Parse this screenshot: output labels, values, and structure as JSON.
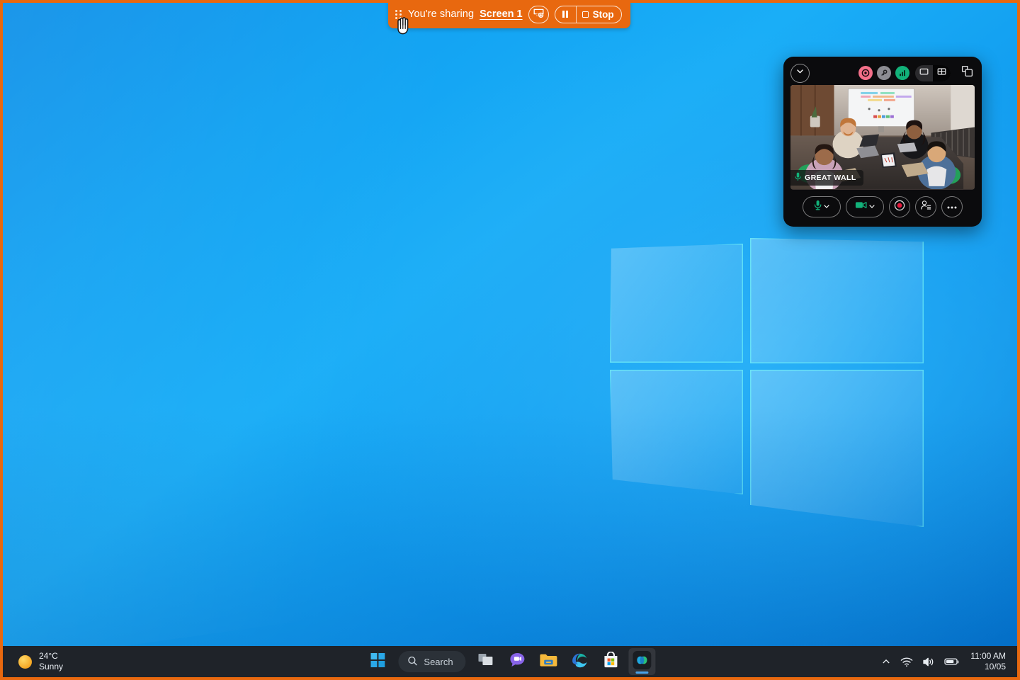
{
  "share_bar": {
    "drag_handle_icon": "drag-dots-icon",
    "prefix_text": "You're sharing",
    "target_label": "Screen 1",
    "share_new_icon": "share-new-content-icon",
    "pause_icon": "pause-icon",
    "pause_label": "Pause",
    "stop_label": "Stop",
    "stop_icon": "stop-square-icon",
    "accent_color": "#e8680f"
  },
  "cursor": {
    "type": "grab-hand-cursor"
  },
  "webex_panel": {
    "collapse_icon": "chevron-down-icon",
    "status_icons": [
      {
        "name": "recording-indicator-icon",
        "color": "#f4708a",
        "label": "Recording"
      },
      {
        "name": "meeting-lock-icon",
        "color": "#8d8d93",
        "label": "Locked"
      },
      {
        "name": "network-signal-icon",
        "color": "#12b27a",
        "label": "Connection good"
      }
    ],
    "layout_toggle": {
      "options": [
        {
          "name": "layout-stack-icon",
          "label": "Stack",
          "active": false
        },
        {
          "name": "layout-grid-icon",
          "label": "Grid",
          "active": true
        }
      ]
    },
    "pip_icon": "picture-in-picture-icon",
    "video": {
      "participant_name": "GREAT WALL",
      "mic_badge_icon": "microphone-on-icon",
      "mic_badge_color": "#12b27a"
    },
    "controls": [
      {
        "name": "mute-button",
        "icon": "microphone-on-icon",
        "label": "Mute",
        "has_chevron": true,
        "accent": "#12b27a"
      },
      {
        "name": "video-button",
        "icon": "camera-on-icon",
        "label": "Stop video",
        "has_chevron": true,
        "accent": "#12b27a"
      },
      {
        "name": "record-button",
        "icon": "record-dot-icon",
        "label": "Record",
        "has_chevron": false,
        "accent": "#e8193c"
      },
      {
        "name": "participants-button",
        "icon": "participants-icon",
        "label": "Participants",
        "has_chevron": false,
        "accent": "#ffffff"
      },
      {
        "name": "more-options-button",
        "icon": "more-horizontal-icon",
        "label": "More options",
        "has_chevron": false,
        "accent": "#ffffff"
      }
    ]
  },
  "taskbar": {
    "weather": {
      "icon": "sun-icon",
      "temperature": "24°C",
      "condition": "Sunny"
    },
    "start_label": "Start",
    "search": {
      "icon": "search-icon",
      "placeholder": "Search",
      "value": "Search"
    },
    "apps": [
      {
        "name": "taskbar-item-start",
        "icon": "windows-logo-icon",
        "label": "Start",
        "active": false
      },
      {
        "name": "taskbar-item-task-view",
        "icon": "task-view-icon",
        "label": "Task View",
        "active": false
      },
      {
        "name": "taskbar-item-chat",
        "icon": "chat-video-icon",
        "label": "Chat",
        "active": false
      },
      {
        "name": "taskbar-item-file-explorer",
        "icon": "folder-icon",
        "label": "File Explorer",
        "active": false
      },
      {
        "name": "taskbar-item-edge",
        "icon": "edge-browser-icon",
        "label": "Microsoft Edge",
        "active": false
      },
      {
        "name": "taskbar-item-store",
        "icon": "store-bag-icon",
        "label": "Microsoft Store",
        "active": false
      },
      {
        "name": "taskbar-item-webex",
        "icon": "webex-logo-icon",
        "label": "Webex",
        "active": true
      }
    ],
    "tray": {
      "overflow_icon": "chevron-up-icon",
      "wifi_icon": "wifi-icon",
      "volume_icon": "volume-icon",
      "battery_icon": "battery-icon",
      "time": "11:00 AM",
      "date": "10/05"
    }
  }
}
